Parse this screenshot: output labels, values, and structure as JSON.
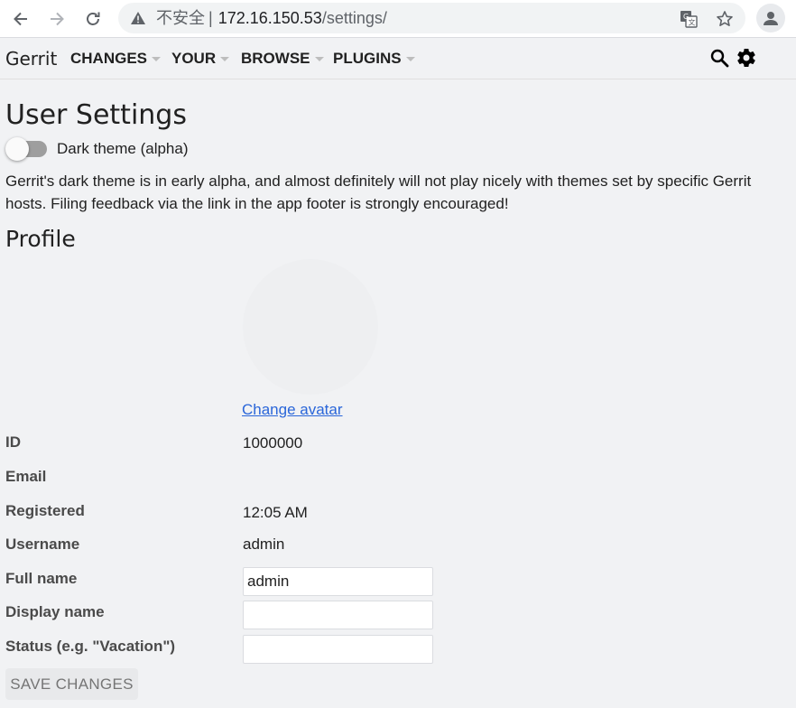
{
  "browser": {
    "omnibox": {
      "insecure_label": "不安全",
      "separator": "|",
      "host": "172.16.150.53",
      "path": "/settings/"
    }
  },
  "header": {
    "brand": "Gerrit",
    "menus": [
      {
        "label": "CHANGES"
      },
      {
        "label": "YOUR"
      },
      {
        "label": "BROWSE"
      },
      {
        "label": "PLUGINS"
      }
    ]
  },
  "settings": {
    "title": "User Settings",
    "dark_theme": {
      "label": "Dark theme (alpha)",
      "enabled": false
    },
    "notice": "Gerrit's dark theme is in early alpha, and almost definitely will not play nicely with themes set by specific Gerrit hosts. Filing feedback via the link in the app footer is strongly encouraged!",
    "profile": {
      "title": "Profile",
      "change_avatar": "Change avatar",
      "fields": {
        "id": {
          "label": "ID",
          "value": "1000000"
        },
        "email": {
          "label": "Email",
          "value": ""
        },
        "registered": {
          "label": "Registered",
          "value": "12:05 AM"
        },
        "username": {
          "label": "Username",
          "value": "admin"
        },
        "full_name": {
          "label": "Full name",
          "value": "admin"
        },
        "display_name": {
          "label": "Display name",
          "value": ""
        },
        "status": {
          "label": "Status (e.g. \"Vacation\")",
          "value": ""
        }
      }
    },
    "save_label": "SAVE CHANGES"
  },
  "icons": [
    "back-arrow-icon",
    "forward-arrow-icon",
    "reload-icon",
    "warning-icon",
    "translate-icon",
    "star-icon",
    "account-icon",
    "search-icon",
    "gear-icon"
  ],
  "colors": {
    "link": "#2a66d9",
    "page_bg": "#f1f2f4"
  }
}
